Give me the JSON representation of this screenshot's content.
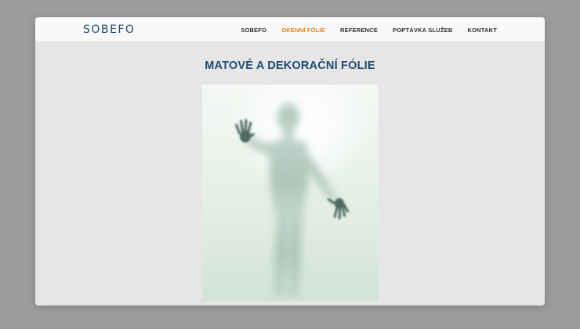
{
  "site": {
    "logo": "SOBEFO"
  },
  "nav": {
    "items": [
      {
        "label": "SOBEFO",
        "active": false
      },
      {
        "label": "OKENNÍ FÓLIE",
        "active": true
      },
      {
        "label": "REFERENCE",
        "active": false
      },
      {
        "label": "POPTÁVKA SLUŽEB",
        "active": false
      },
      {
        "label": "KONTAKT",
        "active": false
      }
    ],
    "active_color": "#e07b14"
  },
  "main": {
    "title": "MATOVÉ A DEKORAČNÍ FÓLIE"
  },
  "colors": {
    "brand": "#1f4a72",
    "page_background": "#e6e6e6",
    "navbar_background": "#f9f9f9"
  }
}
